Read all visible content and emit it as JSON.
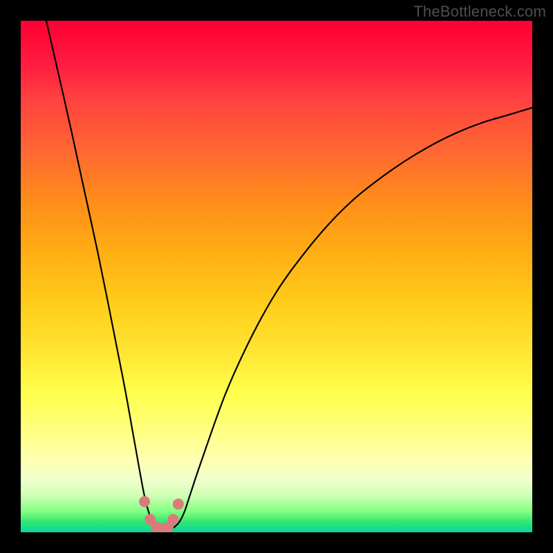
{
  "watermark": "TheBottleneck.com",
  "chart_data": {
    "type": "line",
    "title": "",
    "xlabel": "",
    "ylabel": "",
    "xlim": [
      0,
      100
    ],
    "ylim": [
      0,
      100
    ],
    "grid": false,
    "legend": false,
    "series": [
      {
        "name": "bottleneck-curve",
        "x": [
          5,
          10,
          15,
          20,
          22,
          24,
          25,
          26,
          27,
          28,
          29,
          30,
          31,
          32,
          33,
          35,
          40,
          45,
          50,
          55,
          60,
          65,
          70,
          75,
          80,
          85,
          90,
          95,
          100
        ],
        "values": [
          100,
          78,
          55,
          30,
          19,
          8,
          4,
          1.5,
          0.5,
          0.3,
          0.5,
          1,
          2,
          4,
          7,
          13,
          27,
          38,
          47,
          54,
          60,
          65,
          69,
          72.5,
          75.5,
          78,
          80,
          81.5,
          83
        ]
      }
    ],
    "markers": {
      "name": "highlight-region",
      "x": [
        24.2,
        25.3,
        26.5,
        27.5,
        28.8,
        29.8,
        30.8
      ],
      "values": [
        6.0,
        2.5,
        1.0,
        0.7,
        1.0,
        2.5,
        5.5
      ]
    },
    "gradient_stops": [
      {
        "pos": 0.0,
        "color": "#ff0033"
      },
      {
        "pos": 0.25,
        "color": "#ff6633"
      },
      {
        "pos": 0.5,
        "color": "#ffcc1a"
      },
      {
        "pos": 0.75,
        "color": "#ffff66"
      },
      {
        "pos": 0.93,
        "color": "#ccffb3"
      },
      {
        "pos": 1.0,
        "color": "#06d69e"
      }
    ]
  }
}
